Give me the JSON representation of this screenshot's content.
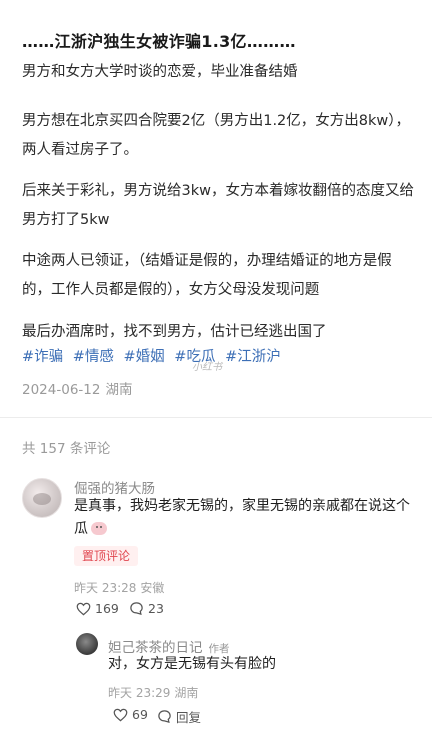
{
  "post": {
    "title": "……江浙沪独生女被诈骗1.3亿………",
    "paragraphs": [
      "男方和女方大学时谈的恋爱，毕业准备结婚",
      "男方想在北京买四合院要2亿（男方出1.2亿，女方出8kw），两人看过房子了。",
      "后来关于彩礼，男方说给3kw，女方本着嫁妆翻倍的态度又给男方打了5kw",
      "中途两人已领证，（结婚证是假的，办理结婚证的地方是假的，工作人员都是假的），女方父母没发现问题",
      "最后办酒席时，找不到男方，估计已经逃出国了"
    ],
    "tags": [
      "#诈骗",
      "#情感",
      "#婚姻",
      "#吃瓜",
      "#江浙沪"
    ],
    "date": "2024-06-12",
    "location": "湖南",
    "watermark": "小红书"
  },
  "comments_header": "共 157 条评论",
  "comments": [
    {
      "user": "倔强的猪大肠",
      "text": "是真事，我妈老家无锡的，家里无锡的亲戚都在说这个瓜",
      "badge": "置顶评论",
      "time": "昨天 23:28",
      "location": "安徽",
      "likes": "169",
      "replies": "23",
      "avatar_icon": "user-avatar-icon"
    },
    {
      "user": "妲己茶茶的日记",
      "author_tag": "作者",
      "text": "对，女方是无锡有头有脸的",
      "time": "昨天 23:29",
      "location": "湖南",
      "likes": "69",
      "reply_label": "回复",
      "avatar_icon": "user-avatar-icon"
    }
  ],
  "colors": {
    "tag_blue": "#3d6fb6",
    "pin_red": "#e0464f",
    "meta_gray": "#9a9a9a"
  }
}
